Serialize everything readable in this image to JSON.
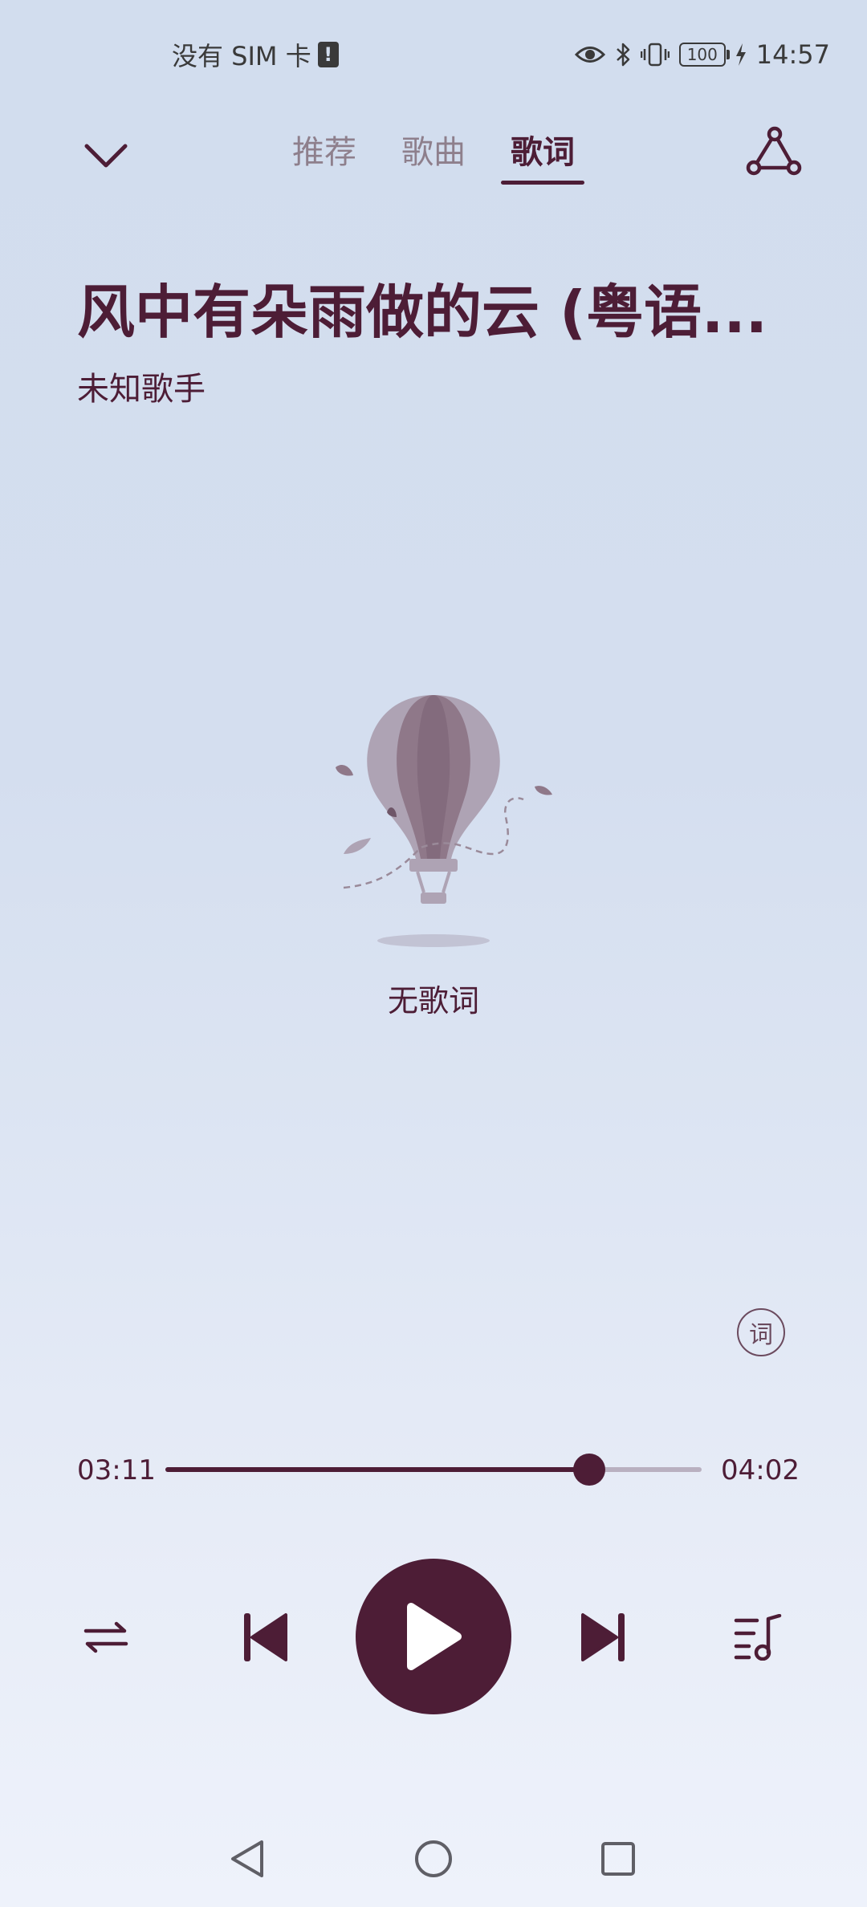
{
  "status_bar": {
    "carrier": "没有 SIM 卡",
    "sim_badge": "!",
    "battery": "100",
    "time": "14:57"
  },
  "header": {
    "tabs": [
      {
        "label": "推荐",
        "active": false
      },
      {
        "label": "歌曲",
        "active": false
      },
      {
        "label": "歌词",
        "active": true
      }
    ]
  },
  "song": {
    "title": "风中有朵雨做的云 (粤语...",
    "artist": "未知歌手"
  },
  "lyrics": {
    "empty_text": "无歌词",
    "toggle_label": "词"
  },
  "progress": {
    "current": "03:11",
    "total": "04:02",
    "fraction": 0.79
  },
  "colors": {
    "accent": "#4d1d36",
    "track": "#b9b0c0"
  },
  "icons": {
    "collapse": "chevron-down-icon",
    "share": "share-icon",
    "repeat": "repeat-icon",
    "prev": "skip-previous-icon",
    "play": "play-icon",
    "next": "skip-next-icon",
    "playlist": "playlist-icon"
  }
}
